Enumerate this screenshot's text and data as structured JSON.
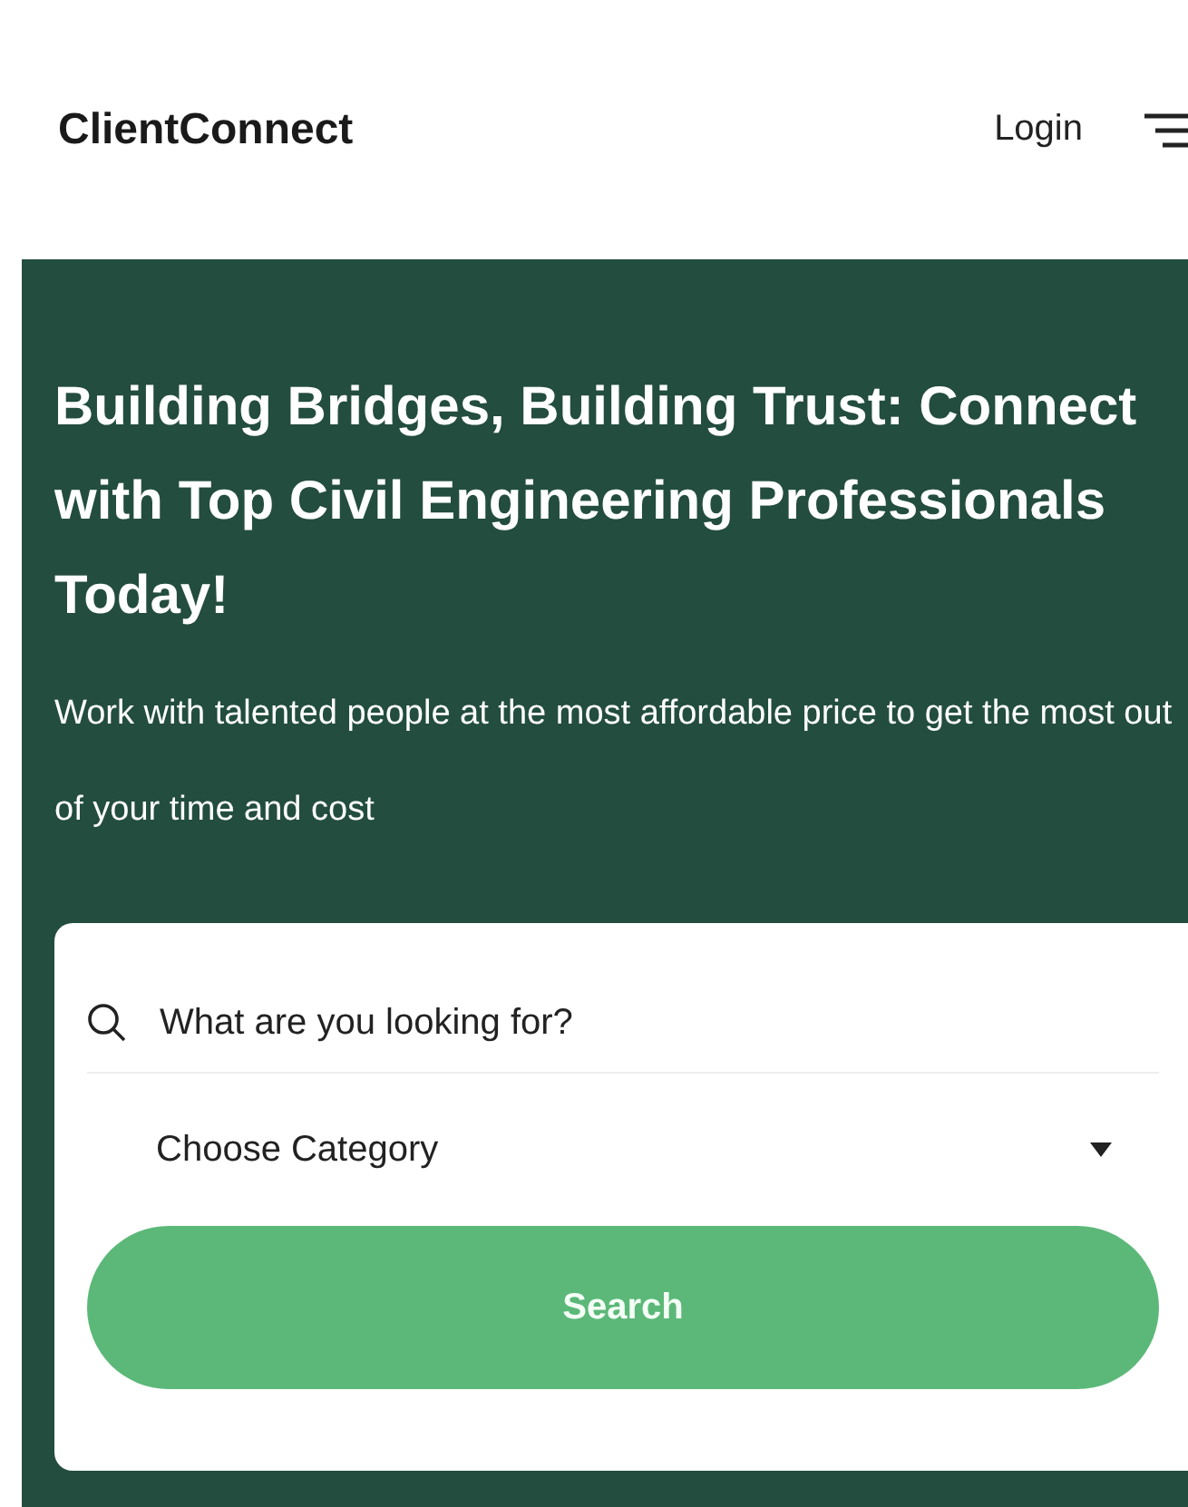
{
  "header": {
    "logo": "ClientConnect",
    "login": "Login"
  },
  "hero": {
    "title": "Building Bridges, Building Trust: Connect with Top Civil Engineering Professionals Today!",
    "subtitle": "Work with talented people at the most affordable price to get the most out of your time and cost"
  },
  "search_form": {
    "search_placeholder": "What are you looking for?",
    "category_placeholder": "Choose Category",
    "button": "Search"
  }
}
